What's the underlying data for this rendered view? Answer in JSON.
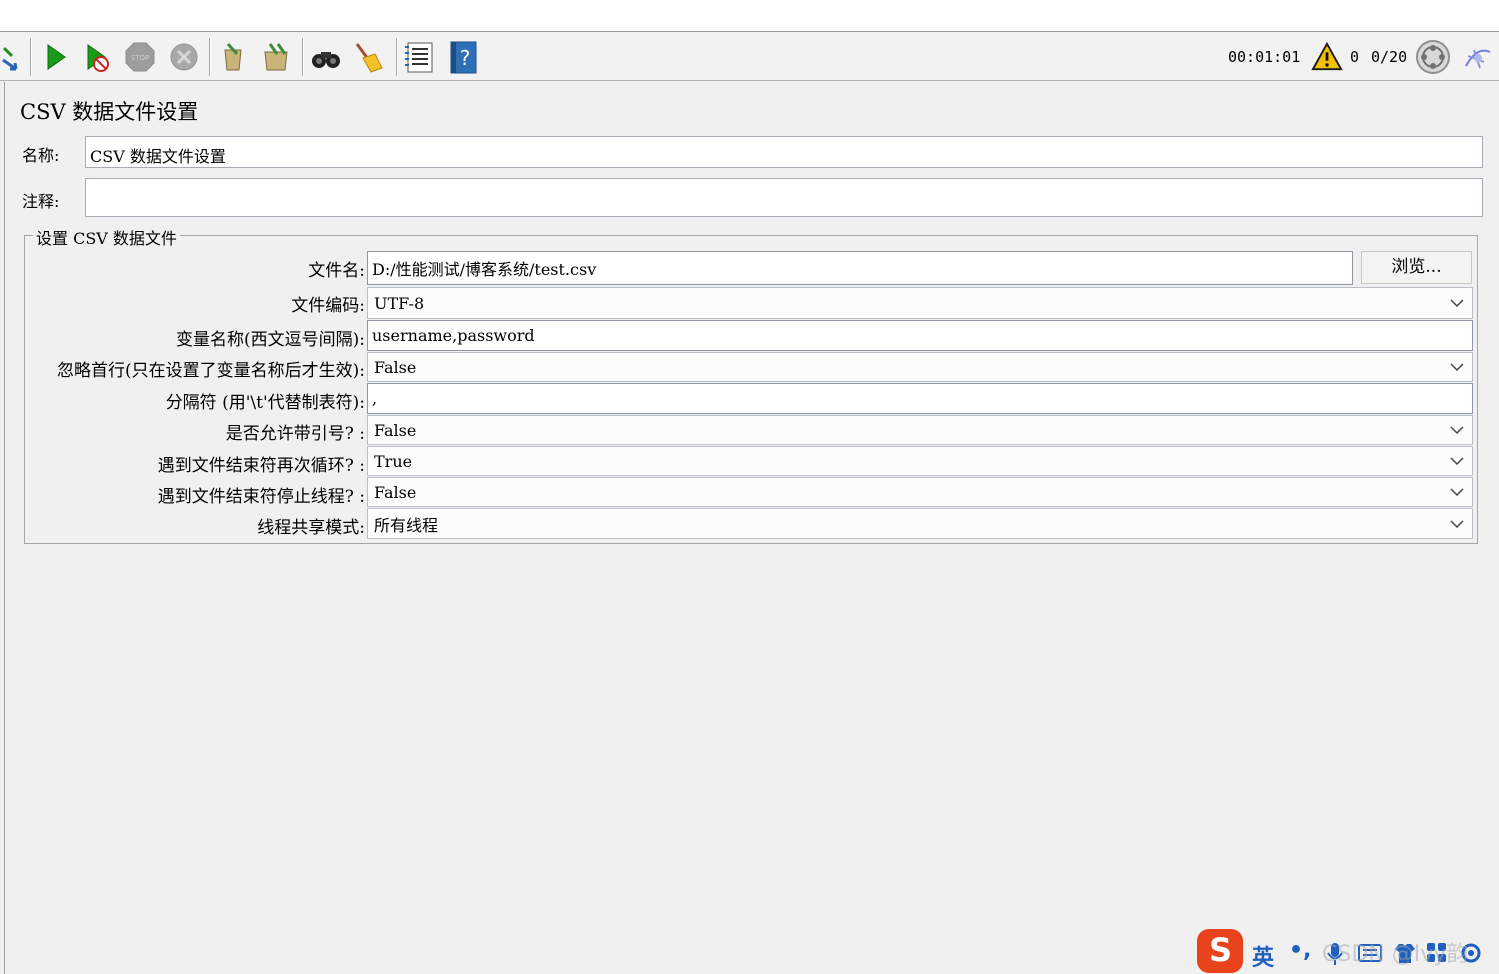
{
  "toolbar": {
    "icons": [
      "clear-all-icon",
      "start-icon",
      "start-no-pause-icon",
      "stop-icon",
      "shutdown-icon",
      "remote-clear-icon",
      "remote-clear-all-icon",
      "search-icon",
      "clear-icon",
      "function-helper-icon",
      "help-icon"
    ],
    "elapsed_time": "00:01:01",
    "warning_count": "0",
    "threads": "0/20",
    "colors": {
      "start": "#1a9a1a",
      "stop": "#9d9d9d",
      "warning": "#f2c200",
      "help": "#2f6fb7"
    }
  },
  "panel": {
    "title": "CSV 数据文件设置",
    "name_label": "名称:",
    "name_value": "CSV 数据文件设置",
    "comment_label": "注释:",
    "comment_value": ""
  },
  "csv_group": {
    "legend": "设置 CSV 数据文件",
    "browse_label": "浏览...",
    "rows": [
      {
        "label": "文件名:",
        "value": "D:/性能测试/博客系统/test.csv",
        "kind": "text"
      },
      {
        "label": "文件编码:",
        "value": "UTF-8",
        "kind": "select"
      },
      {
        "label": "变量名称(西文逗号间隔):",
        "value": "username,password",
        "kind": "text"
      },
      {
        "label": "忽略首行(只在设置了变量名称后才生效):",
        "value": "False",
        "kind": "select"
      },
      {
        "label": "分隔符 (用'\\t'代替制表符):",
        "value": ",",
        "kind": "text"
      },
      {
        "label": "是否允许带引号? :",
        "value": "False",
        "kind": "select"
      },
      {
        "label": "遇到文件结束符再次循环? :",
        "value": "True",
        "kind": "select"
      },
      {
        "label": "遇到文件结束符停止线程? :",
        "value": "False",
        "kind": "select"
      },
      {
        "label": "线程共享模式:",
        "value": "所有线程",
        "kind": "select"
      }
    ]
  },
  "ime_bar": {
    "logo": "S",
    "mode": "英",
    "punct": "•,",
    "icons": [
      "microphone-icon",
      "keyboard-icon",
      "shirt-icon",
      "apps-icon",
      "settings-icon"
    ],
    "watermark": "CSDN @Ivy韵",
    "brand_color": "#e8431c"
  }
}
